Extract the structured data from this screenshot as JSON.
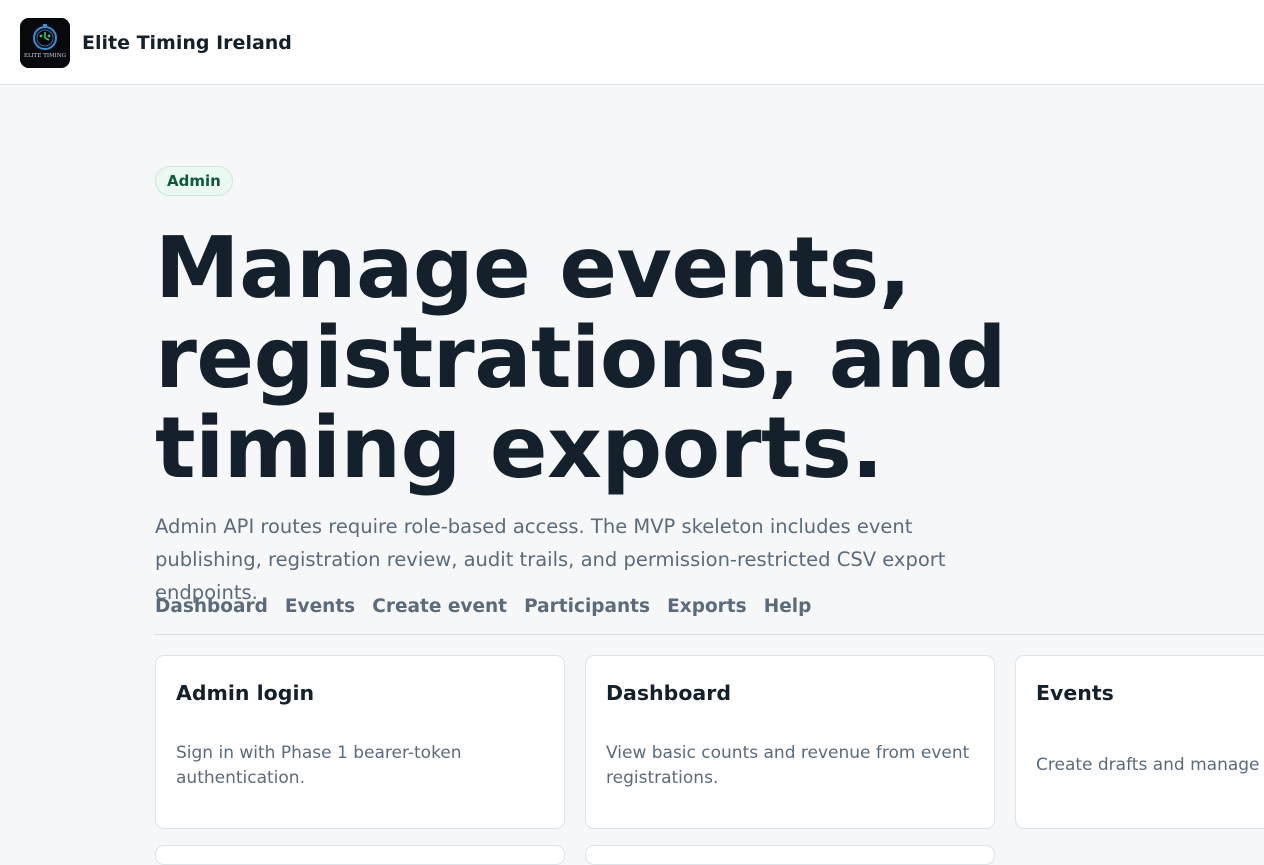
{
  "header": {
    "brand_name": "Elite Timing Ireland",
    "logo_text": "ELITE TIMING"
  },
  "hero": {
    "badge": "Admin",
    "title": "Manage events, registrations, and timing exports.",
    "intro": "Admin API routes require role-based access. The MVP skeleton includes event publishing, registration review, audit trails, and permission-restricted CSV export endpoints."
  },
  "subnav": {
    "items": [
      "Dashboard",
      "Events",
      "Create event",
      "Participants",
      "Exports",
      "Help"
    ]
  },
  "cards": [
    {
      "title": "Admin login",
      "description": "Sign in with Phase 1 bearer-token authentication."
    },
    {
      "title": "Dashboard",
      "description": "View basic counts and revenue from event registrations."
    },
    {
      "title": "Events",
      "description": "Create drafts and manage ca"
    }
  ],
  "colors": {
    "page_background": "#f5f7f9",
    "text_primary": "#14202b",
    "text_muted": "#5b6b7b",
    "badge_text": "#0f5a3d",
    "badge_background": "#ecf8f2"
  }
}
